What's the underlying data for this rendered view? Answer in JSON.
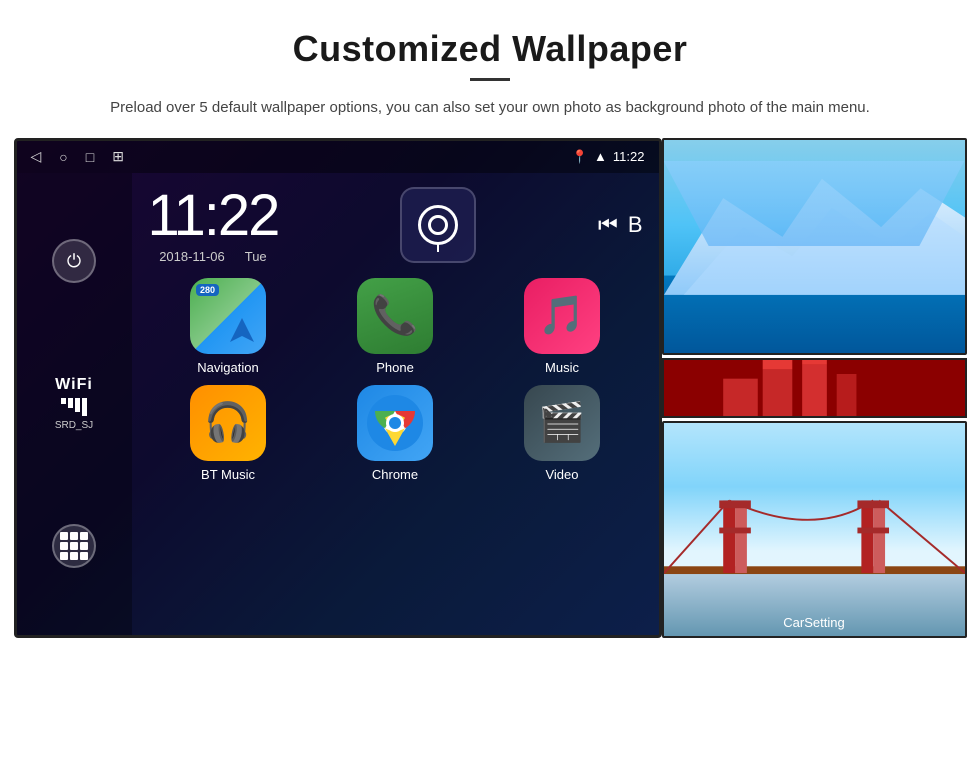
{
  "header": {
    "title": "Customized Wallpaper",
    "subtitle": "Preload over 5 default wallpaper options, you can also set your own photo as background photo of the main menu."
  },
  "android": {
    "status_bar": {
      "time": "11:22",
      "nav_buttons": [
        "◁",
        "○",
        "□",
        "⊞"
      ]
    },
    "clock": {
      "time": "11:22",
      "date": "2018-11-06",
      "day": "Tue"
    },
    "wifi": {
      "label": "WiFi",
      "ssid": "SRD_SJ"
    },
    "apps": [
      {
        "name": "Navigation",
        "type": "navigation",
        "badge": "280"
      },
      {
        "name": "Phone",
        "type": "phone"
      },
      {
        "name": "Music",
        "type": "music"
      },
      {
        "name": "BT Music",
        "type": "bt"
      },
      {
        "name": "Chrome",
        "type": "chrome"
      },
      {
        "name": "Video",
        "type": "video"
      }
    ]
  },
  "wallpapers": {
    "top_label": "",
    "middle_label": "",
    "bottom_label": "CarSetting"
  }
}
